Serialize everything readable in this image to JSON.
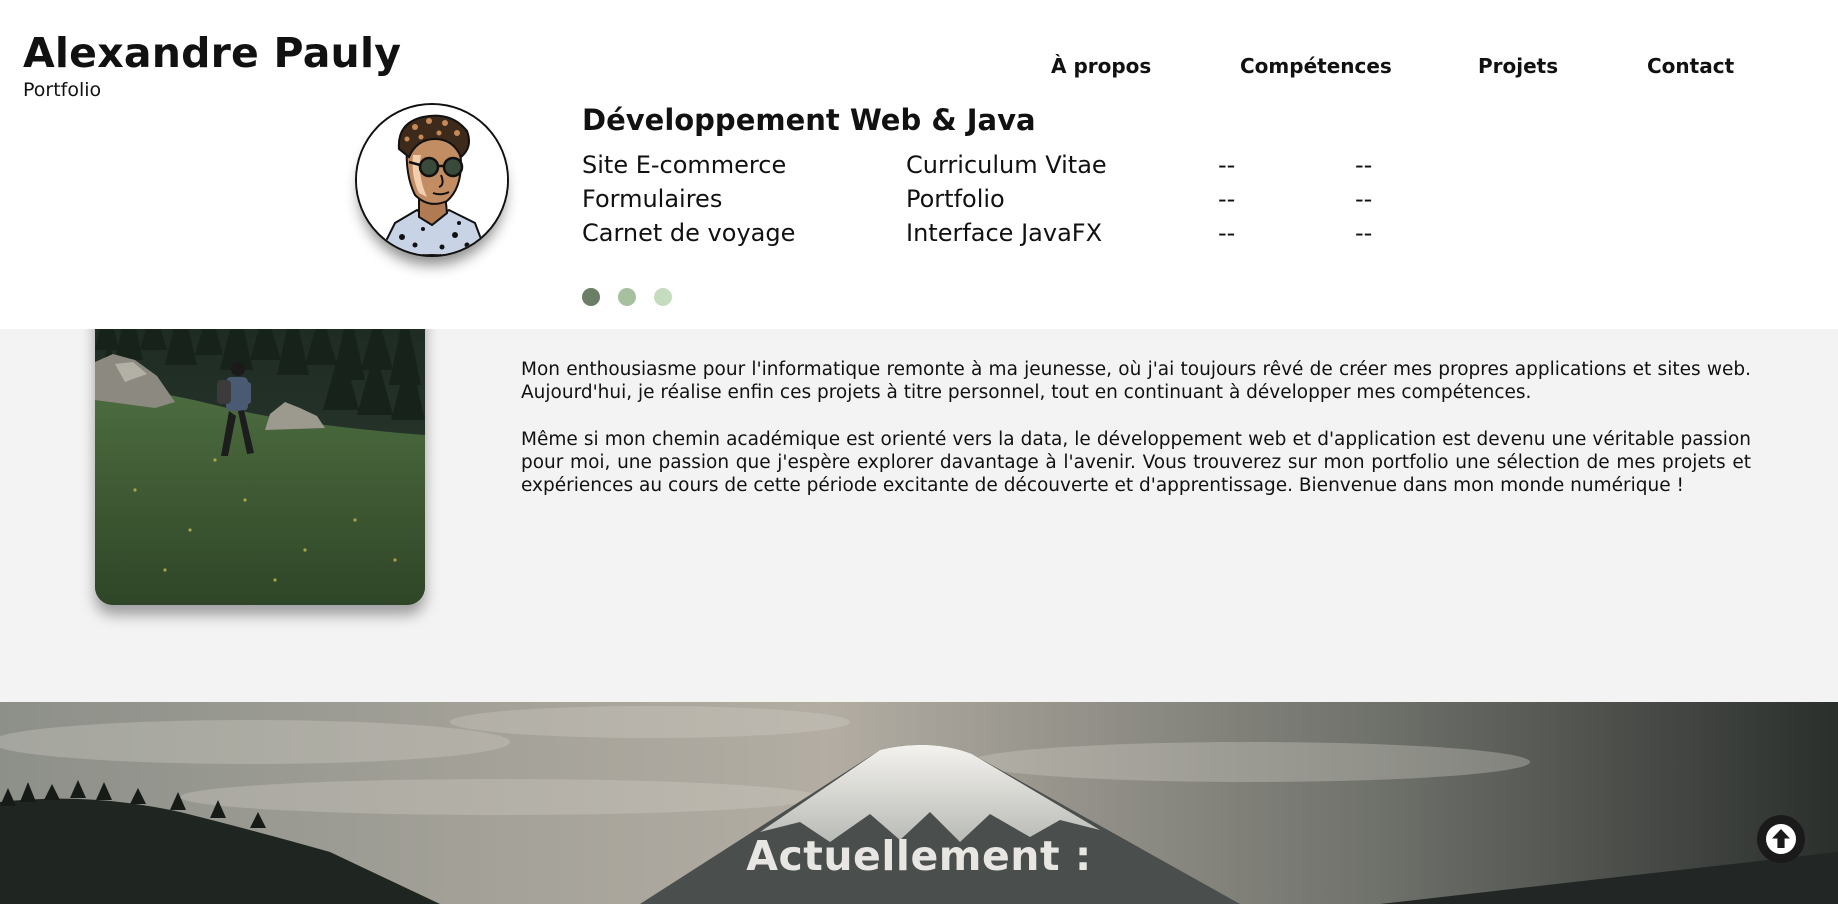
{
  "header": {
    "name": "Alexandre Pauly",
    "subtitle": "Portfolio"
  },
  "nav": [
    {
      "label": "À propos"
    },
    {
      "label": "Compétences"
    },
    {
      "label": "Projets"
    },
    {
      "label": "Contact"
    }
  ],
  "dropdown": {
    "title": "Développement Web & Java",
    "columns": [
      [
        "Site E-commerce",
        "Formulaires",
        "Carnet de voyage"
      ],
      [
        "Curriculum Vitae",
        "Portfolio",
        "Interface JavaFX"
      ],
      [
        "--",
        "--",
        "--"
      ],
      [
        "--",
        "--",
        "--"
      ]
    ],
    "dots": [
      {
        "color": "#6b7f66",
        "active": true
      },
      {
        "color": "#a7c0a0",
        "active": false
      },
      {
        "color": "#c5ddbe",
        "active": false
      }
    ]
  },
  "about": {
    "paragraphs": [
      "Mon enthousiasme pour l'informatique remonte à ma jeunesse, où j'ai toujours rêvé de créer mes propres applications et sites web. Aujourd'hui, je réalise enfin ces projets à titre personnel, tout en continuant à développer mes compétences.",
      "Même si mon chemin académique est orienté vers la data, le développement web et d'application est devenu une véritable passion pour moi, une passion que j'espère explorer davantage à l'avenir. Vous trouverez sur mon portfolio une sélection de mes projets et expériences au cours de cette période excitante de découverte et d'apprentissage. Bienvenue dans mon monde numérique !"
    ]
  },
  "current": {
    "title": "Actuellement :"
  },
  "icons": {
    "avatar": "cartoon-portrait",
    "scroll_top": "arrow-up-icon"
  },
  "colors": {
    "header_bg": "#ffffff",
    "page_bg": "#f3f3f3",
    "scroll_button": "#1a1a1a"
  }
}
